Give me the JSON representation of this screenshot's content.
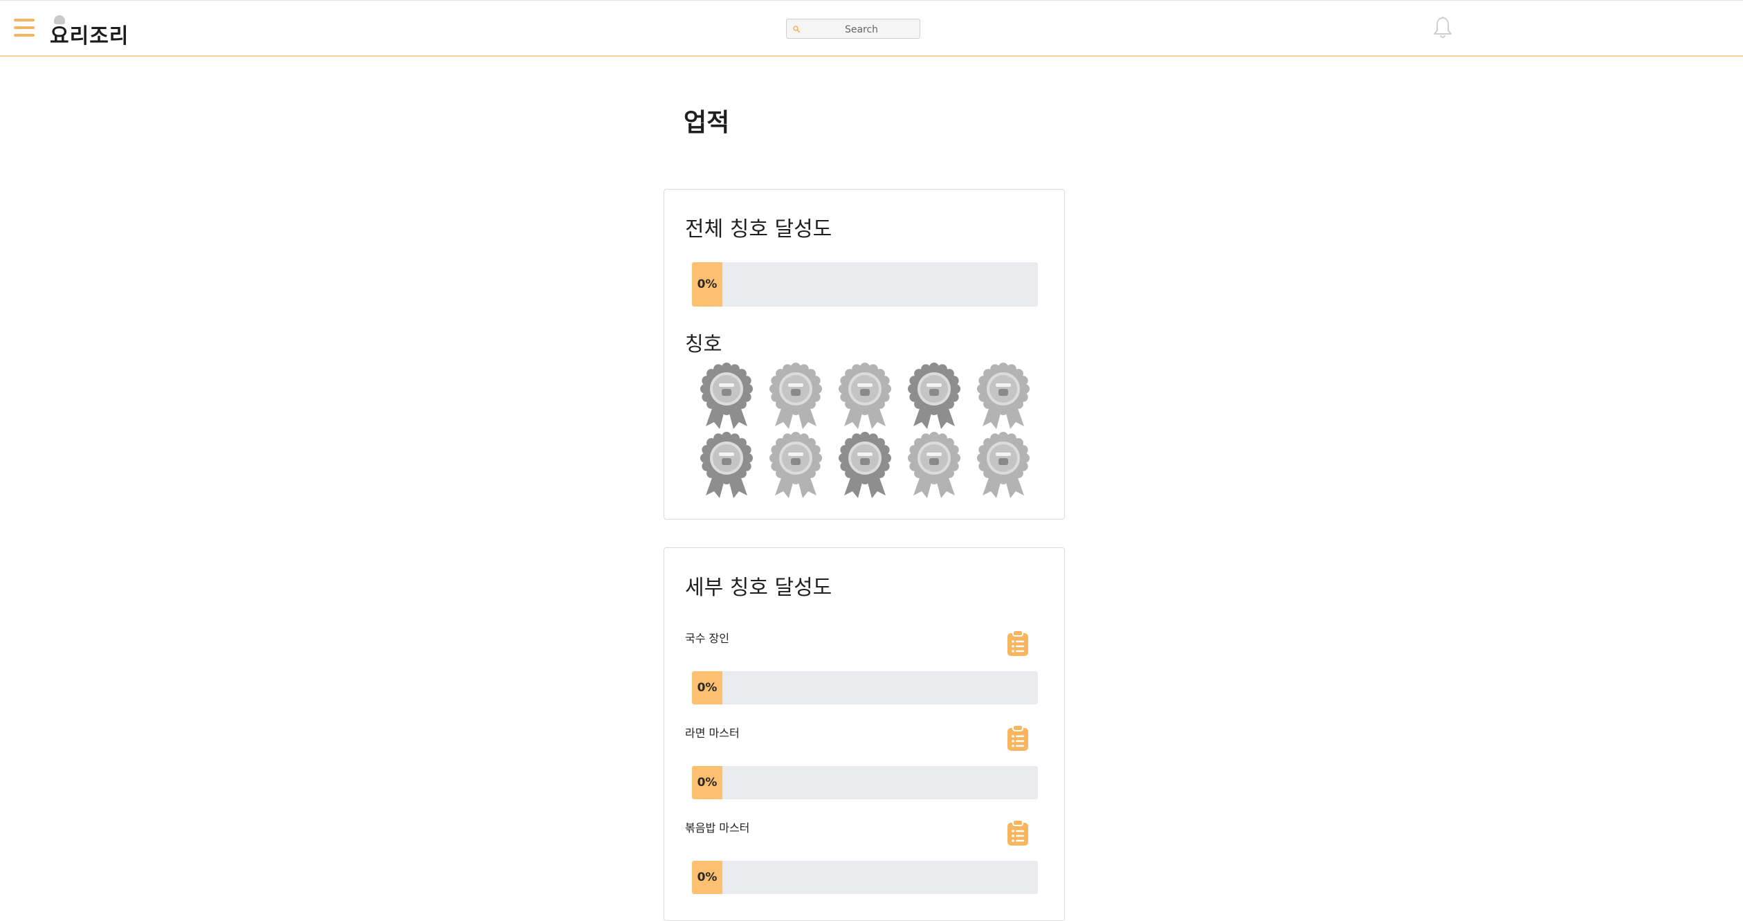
{
  "header": {
    "logo_text": "요리조리",
    "search": {
      "placeholder": "Search",
      "value": ""
    }
  },
  "page": {
    "title": "업적"
  },
  "overall": {
    "title": "전체 칭호 달성도",
    "progress_label": "0%",
    "progress_fraction": 0,
    "badges_label": "칭호",
    "badges": [
      {
        "icon": "noodle-badge-icon"
      },
      {
        "icon": "ramen-badge-icon"
      },
      {
        "icon": "fried-rice-badge-icon"
      },
      {
        "icon": "seafood-badge-icon"
      },
      {
        "icon": "salad-badge-icon"
      },
      {
        "icon": "drink-badge-icon"
      },
      {
        "icon": "knife-badge-icon"
      },
      {
        "icon": "pot-badge-icon"
      },
      {
        "icon": "rabbit-badge-icon"
      },
      {
        "icon": "flower-badge-icon"
      }
    ]
  },
  "detail": {
    "title": "세부 칭호 달성도",
    "items": [
      {
        "name": "국수 장인",
        "progress_label": "0%",
        "progress_fraction": 0
      },
      {
        "name": "라면 마스터",
        "progress_label": "0%",
        "progress_fraction": 0
      },
      {
        "name": "볶음밥 마스터",
        "progress_label": "0%",
        "progress_fraction": 0
      }
    ]
  },
  "colors": {
    "accent": "#f5b461",
    "progress_fill": "#fdbf70",
    "progress_track": "#e8eaed",
    "badge_dark": "#8e8e8e",
    "badge_light": "#b3b3b3"
  }
}
